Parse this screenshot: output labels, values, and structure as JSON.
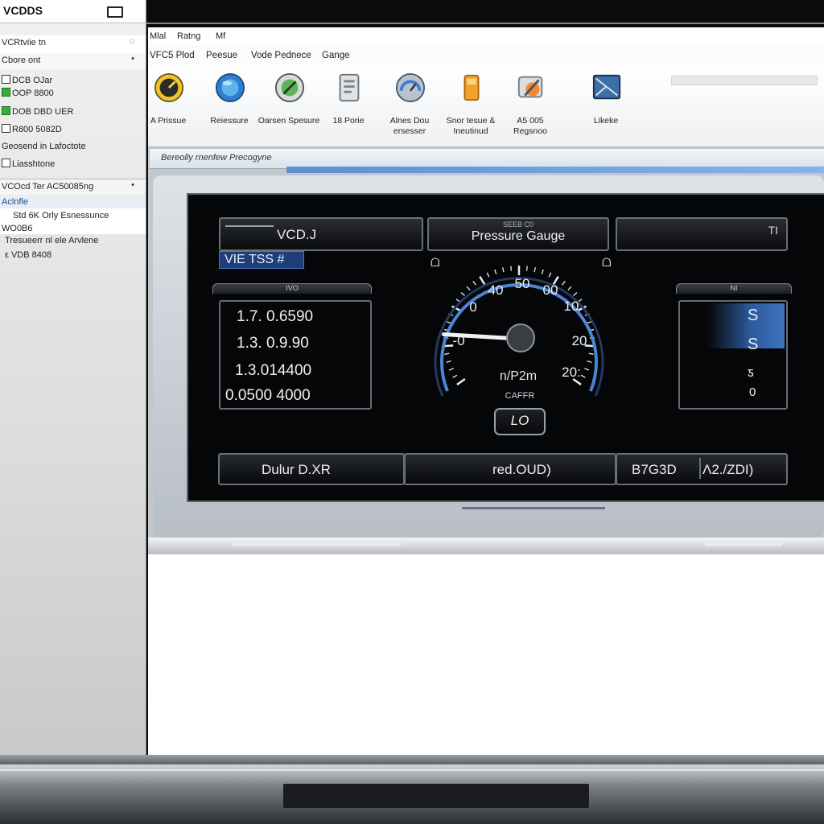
{
  "sidebar": {
    "title": "VCDDS",
    "rows": [
      {
        "label": "VCRtviie tn",
        "right": "◌"
      },
      {
        "label": "Cbore ont",
        "right": "•"
      },
      {
        "label": "DCB OJar",
        "box": "plain"
      },
      {
        "label": "OOP 8800",
        "box": "green"
      },
      {
        "label": "DOB DBD UER",
        "box": "green"
      },
      {
        "label": "R800 5082D",
        "box": "plain"
      },
      {
        "label": "Geosend in Lafoctote"
      },
      {
        "label": "Liasshtone",
        "box": "plain"
      },
      {
        "label": "VCOcd Ter AC50085ng",
        "right": "•"
      },
      {
        "label": "Aclnfle"
      },
      {
        "label": "Std 6K Orly Esnessunce"
      },
      {
        "label": "WO0B6"
      },
      {
        "label": "Tresueerr nl ele Arvlene"
      },
      {
        "label": "ε VDB 8408"
      }
    ]
  },
  "menubar": [
    "Mlal",
    "Ratng",
    "Mf"
  ],
  "tabs": [
    "VFC5 Plod",
    "Peesue",
    "Vode Pednece",
    "Gange"
  ],
  "toolbar": [
    {
      "label": "A Prissue",
      "icon": "gauge-icon"
    },
    {
      "label": "Reiessure",
      "icon": "globe-icon"
    },
    {
      "label": "Oarsen Spesure",
      "icon": "dial-icon"
    },
    {
      "label": "18 Porie",
      "icon": "document-icon"
    },
    {
      "label": "Alnes Dou ersesser",
      "icon": "meter-icon"
    },
    {
      "label": "Snor tesue & Ineutinud",
      "icon": "battery-icon"
    },
    {
      "label": "A5 005 Regsnoo",
      "icon": "tools-icon"
    },
    {
      "label": "Likeke",
      "icon": "screen-icon"
    }
  ],
  "content": {
    "header": "Bereolly rnenfew Precogyne"
  },
  "panel": {
    "btn_vcd": "VCD.J",
    "btn_pg_sub": "SEEB C0",
    "btn_pg": "Pressure Gauge",
    "btn_right": "TI",
    "vie_label": "VIE TSS #",
    "glyph_left": "ᗝ",
    "glyph_right": "ᗝ",
    "left_tab": "IVO",
    "readouts": [
      "1.7. 0.6590",
      "1.3. 0.9.90",
      "1.3.014400",
      "0.0500 4000"
    ],
    "right_tab": "NI",
    "indicators": [
      "S",
      "S",
      "ƽ",
      "0"
    ],
    "gauge": {
      "ticks": [
        "0",
        "40",
        "50",
        "00",
        "10",
        "-0",
        "20",
        "20:"
      ],
      "unit": "n/P2m",
      "caption": "CAFFR",
      "needle_value": 0.18
    },
    "lo_button": "LO",
    "bottom": [
      "Dulur D.XR",
      "red.OUD)",
      "B7G3D",
      "Λ2./ZDI)"
    ]
  },
  "colors": {
    "accent": "#3f73bf",
    "gauge_arc": "#4a86d6",
    "screen_bg": "#050608"
  }
}
